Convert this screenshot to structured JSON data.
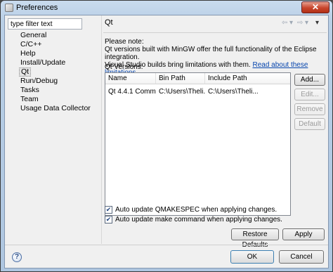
{
  "window": {
    "title": "Preferences",
    "close_glyph": "✕"
  },
  "filter": {
    "value": "type filter text"
  },
  "tree": {
    "items": [
      {
        "label": "General"
      },
      {
        "label": "C/C++"
      },
      {
        "label": "Help"
      },
      {
        "label": "Install/Update"
      },
      {
        "label": "Qt"
      },
      {
        "label": "Run/Debug"
      },
      {
        "label": "Tasks"
      },
      {
        "label": "Team"
      },
      {
        "label": "Usage Data Collector"
      }
    ],
    "selected": "Qt"
  },
  "page": {
    "title": "Qt",
    "nav": {
      "back": "⇦",
      "back_menu": "▾",
      "forward": "⇨",
      "forward_menu": "▾",
      "view_menu": "▾"
    },
    "note_line1": "Please note:",
    "note_line2": "Qt versions built with MinGW offer the full functionality of the Eclipse integration.",
    "note_line3_text": "Visual Studio builds bring limitations with them. ",
    "note_link": "Read about these limitations",
    "versions_label": "Qt Versions:",
    "table": {
      "columns": [
        "Name",
        "Bin Path",
        "Include Path"
      ],
      "rows": [
        [
          "Qt 4.4.1 Comm...",
          "C:\\Users\\Theli...",
          "C:\\Users\\Theli..."
        ]
      ]
    },
    "buttons": {
      "add": "Add...",
      "edit": "Edit...",
      "remove": "Remove",
      "default": "Default"
    },
    "checks": [
      {
        "label": "Auto update QMAKESPEC when applying changes.",
        "checked": true,
        "mark": "✔"
      },
      {
        "label": "Auto update make command when applying changes.",
        "checked": true,
        "mark": "✔"
      }
    ],
    "restore_defaults": "Restore Defaults",
    "apply": "Apply"
  },
  "footer": {
    "help_glyph": "?",
    "ok": "OK",
    "cancel": "Cancel"
  }
}
